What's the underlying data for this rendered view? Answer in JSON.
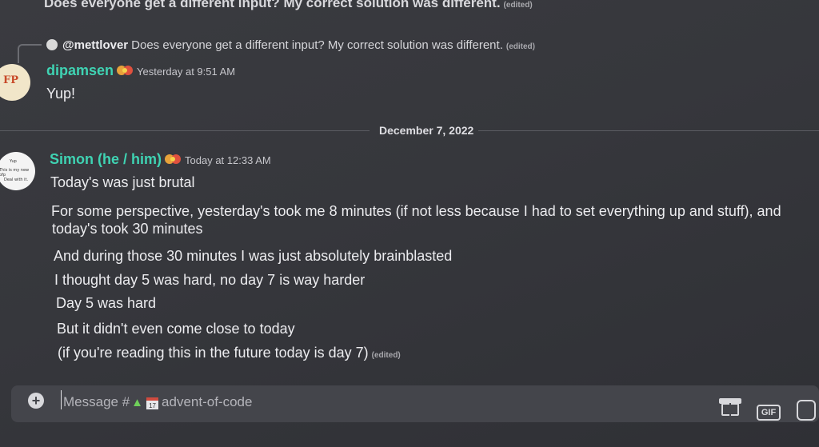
{
  "top_message": {
    "text": "Does everyone get a different input? My correct solution was different.",
    "edited": "(edited)"
  },
  "reply": {
    "author": "@mettlover",
    "text": "Does everyone get a different input? My correct solution was different.",
    "edited": "(edited)"
  },
  "message_dipamsen": {
    "avatar_text": "FP",
    "username": "dipamsen",
    "timestamp": "Yesterday at 9:51 AM",
    "text": "Yup!"
  },
  "date_divider": "December 7, 2022",
  "message_simon": {
    "avatar_lines": [
      "Yup",
      "This is my new pfp",
      "Deal with it."
    ],
    "username": "Simon (he / him)",
    "timestamp": "Today at 12:33 AM",
    "lines": [
      "Today's was just brutal",
      "For some perspective, yesterday's took me 8 minutes (if not less because I had to set everything up and stuff), and",
      "today's took 30 minutes",
      "And during those 30 minutes I was just absolutely brainblasted",
      "I thought day 5 was hard, no day 7 is way harder",
      "Day 5 was hard",
      "But it didn't even come close to today",
      "(if you're reading this in the future today is day 7)"
    ],
    "last_edited": "(edited)"
  },
  "composer": {
    "placeholder_prefix": "Message #",
    "calendar_day": "17",
    "channel_name": "advent-of-code",
    "gif_label": "GIF"
  },
  "colors": {
    "username": "#3fd3b3",
    "background": "#36373c",
    "composer": "#44454b"
  },
  "icons": [
    "plus-icon",
    "tree-icon",
    "calendar-icon",
    "gift-icon",
    "gif-icon",
    "sticker-icon",
    "nitro-badge-icon"
  ]
}
